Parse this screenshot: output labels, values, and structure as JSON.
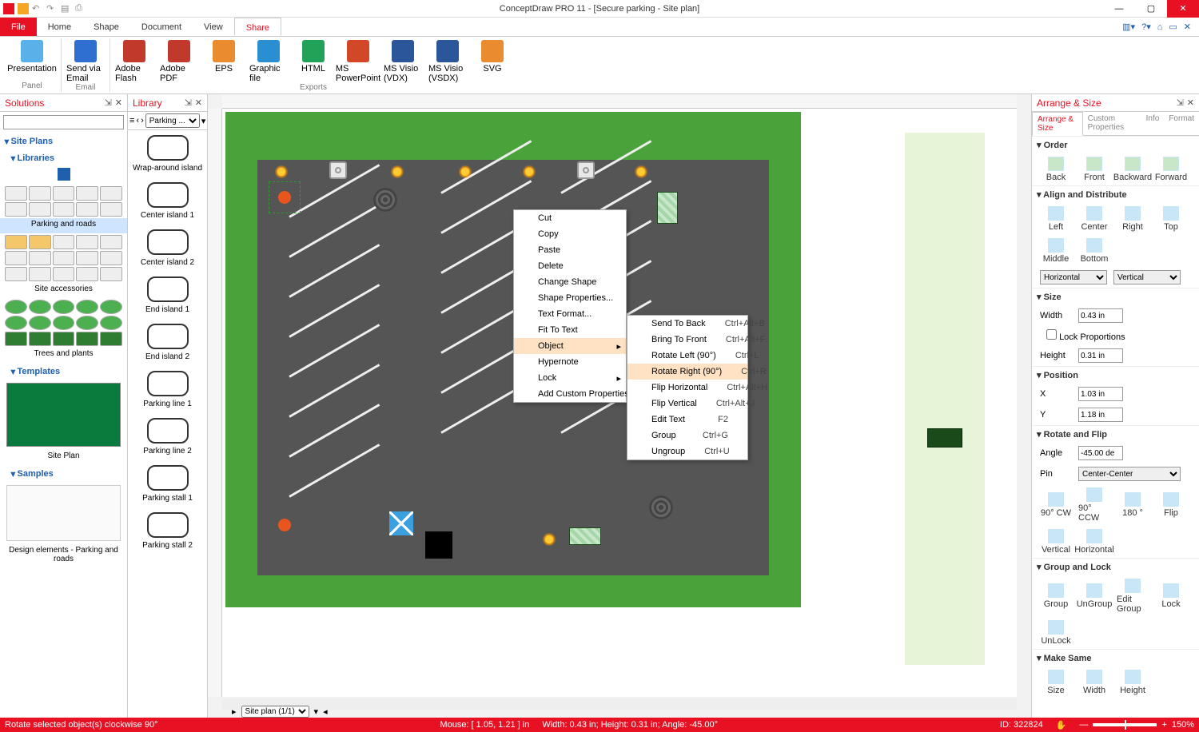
{
  "app": {
    "title": "ConceptDraw PRO 11 - [Secure parking - Site plan]"
  },
  "menutabs": [
    "File",
    "Home",
    "Shape",
    "Document",
    "View",
    "Share"
  ],
  "active_tab": "Share",
  "ribbon": {
    "groups": [
      {
        "name": "Panel",
        "items": [
          {
            "label": "Presentation",
            "color": "#5ab0e8"
          }
        ]
      },
      {
        "name": "Email",
        "items": [
          {
            "label": "Send via Email",
            "color": "#2e6fd1"
          }
        ]
      },
      {
        "name": "Exports",
        "items": [
          {
            "label": "Adobe Flash",
            "color": "#c0392b"
          },
          {
            "label": "Adobe PDF",
            "color": "#c0392b"
          },
          {
            "label": "EPS",
            "color": "#e98b2e"
          },
          {
            "label": "Graphic file",
            "color": "#2a8fd1"
          },
          {
            "label": "HTML",
            "color": "#22a258"
          },
          {
            "label": "MS PowerPoint",
            "color": "#d24726"
          },
          {
            "label": "MS Visio (VDX)",
            "color": "#2b579a"
          },
          {
            "label": "MS Visio (VSDX)",
            "color": "#2b579a"
          },
          {
            "label": "SVG",
            "color": "#e98b2e"
          }
        ]
      }
    ]
  },
  "solutions": {
    "title": "Solutions",
    "root": "Site Plans",
    "sections": {
      "libraries": "Libraries",
      "templates": "Templates",
      "samples": "Samples"
    },
    "library_groups": [
      {
        "label": "Parking and roads",
        "selected": true
      },
      {
        "label": "Site accessories"
      },
      {
        "label": "Trees and plants"
      }
    ],
    "template_label": "Site Plan",
    "sample_label": "Design elements - Parking and roads"
  },
  "library": {
    "title": "Library",
    "dropdown": "Parking ...",
    "items": [
      "Wrap-around island",
      "Center island 1",
      "Center island 2",
      "End island 1",
      "End island 2",
      "Parking line 1",
      "Parking line 2",
      "Parking stall 1",
      "Parking stall 2"
    ]
  },
  "context_menu_1": [
    {
      "label": "Cut",
      "u": "t"
    },
    {
      "label": "Copy",
      "u": "C"
    },
    {
      "label": "Paste",
      "u": "P"
    },
    {
      "label": "Delete",
      "u": "D"
    },
    {
      "label": "Change Shape"
    },
    {
      "label": "Shape Properties..."
    },
    {
      "label": "Text Format..."
    },
    {
      "label": "Fit To Text"
    },
    {
      "label": "Object",
      "sub": true,
      "hl": true
    },
    {
      "label": "Hypernote"
    },
    {
      "label": "Lock",
      "sub": true
    },
    {
      "label": "Add Custom Properties"
    }
  ],
  "context_menu_2": [
    {
      "label": "Send To Back",
      "sc": "Ctrl+Alt+B"
    },
    {
      "label": "Bring To Front",
      "sc": "Ctrl+Alt+F"
    },
    {
      "label": "Rotate Left (90°)",
      "sc": "Ctrl+L"
    },
    {
      "label": "Rotate Right (90°)",
      "sc": "Ctrl+R",
      "hl": true
    },
    {
      "label": "Flip Horizontal",
      "sc": "Ctrl+Alt+H"
    },
    {
      "label": "Flip Vertical",
      "sc": "Ctrl+Alt+J"
    },
    {
      "label": "Edit Text",
      "sc": "F2"
    },
    {
      "label": "Group",
      "sc": "Ctrl+G"
    },
    {
      "label": "Ungroup",
      "sc": "Ctrl+U"
    }
  ],
  "sheet_tab": "Site plan (1/1)",
  "arrange": {
    "title": "Arrange & Size",
    "tabs": [
      "Arrange & Size",
      "Custom Properties",
      "Info",
      "Format"
    ],
    "order": {
      "hdr": "Order",
      "items": [
        "Back",
        "Front",
        "Backward",
        "Forward"
      ]
    },
    "align": {
      "hdr": "Align and Distribute",
      "row1": [
        "Left",
        "Center",
        "Right",
        "Top",
        "Middle",
        "Bottom"
      ],
      "horiz": "Horizontal",
      "vert": "Vertical"
    },
    "size": {
      "hdr": "Size",
      "width_lbl": "Width",
      "width": "0.43 in",
      "height_lbl": "Height",
      "height": "0.31 in",
      "lock": "Lock Proportions"
    },
    "position": {
      "hdr": "Position",
      "x_lbl": "X",
      "x": "1.03 in",
      "y_lbl": "Y",
      "y": "1.18 in"
    },
    "rotate": {
      "hdr": "Rotate and Flip",
      "angle_lbl": "Angle",
      "angle": "-45.00 de",
      "pin_lbl": "Pin",
      "pin": "Center-Center",
      "items": [
        "90° CW",
        "90° CCW",
        "180 °",
        "Flip",
        "Vertical",
        "Horizontal"
      ]
    },
    "group": {
      "hdr": "Group and Lock",
      "items": [
        "Group",
        "UnGroup",
        "Edit Group",
        "Lock",
        "UnLock"
      ]
    },
    "same": {
      "hdr": "Make Same",
      "items": [
        "Size",
        "Width",
        "Height"
      ]
    }
  },
  "status": {
    "hint": "Rotate selected object(s) clockwise 90°",
    "mouse": "Mouse: [ 1.05, 1.21 ] in",
    "dims": "Width: 0.43 in;  Height: 0.31 in;  Angle: -45.00°",
    "id": "ID: 322824",
    "zoom": "150%"
  }
}
